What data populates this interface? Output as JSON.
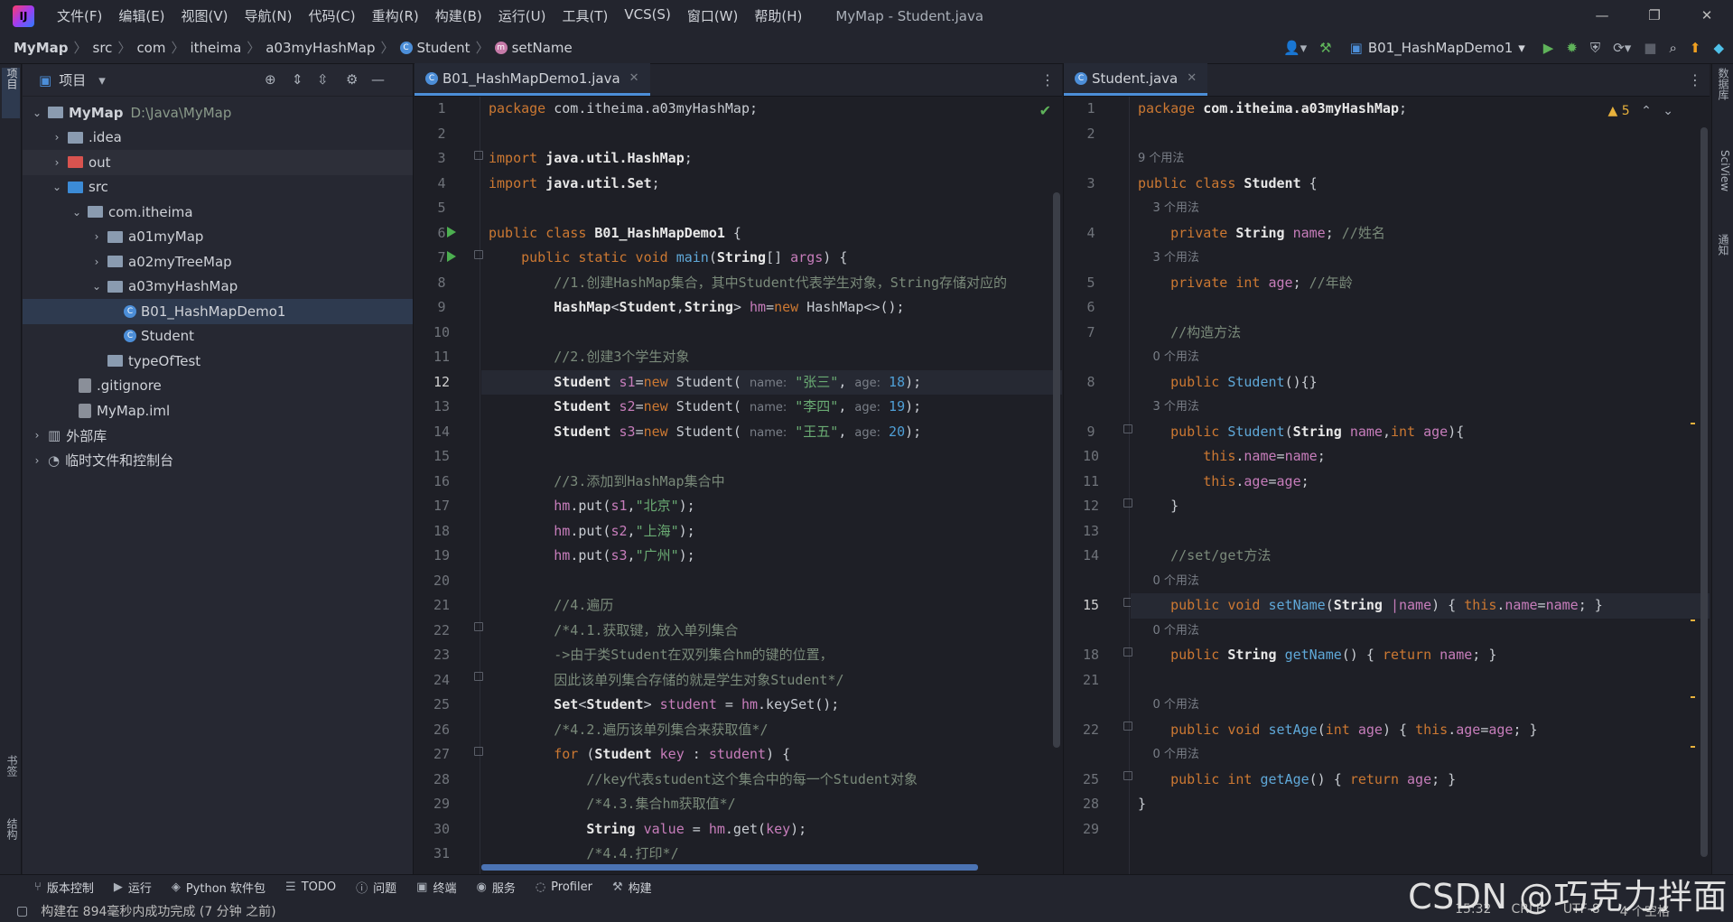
{
  "titlebar": {
    "logo": "IJ",
    "menu": [
      "文件(F)",
      "编辑(E)",
      "视图(V)",
      "导航(N)",
      "代码(C)",
      "重构(R)",
      "构建(B)",
      "运行(U)",
      "工具(T)",
      "VCS(S)",
      "窗口(W)",
      "帮助(H)"
    ],
    "title": "MyMap - Student.java"
  },
  "breadcrumb": [
    "MyMap",
    "src",
    "com",
    "itheima",
    "a03myHashMap",
    "Student",
    "setName"
  ],
  "run_config": "B01_HashMapDemo1",
  "project": {
    "header": "项目",
    "tree": [
      {
        "name": "MyMap",
        "path": "D:\\Java\\MyMap"
      },
      {
        "name": ".idea"
      },
      {
        "name": "out"
      },
      {
        "name": "src"
      },
      {
        "name": "com.itheima"
      },
      {
        "name": "a01myMap"
      },
      {
        "name": "a02myTreeMap"
      },
      {
        "name": "a03myHashMap"
      },
      {
        "name": "B01_HashMapDemo1"
      },
      {
        "name": "Student"
      },
      {
        "name": "typeOfTest"
      },
      {
        "name": ".gitignore"
      },
      {
        "name": "MyMap.iml"
      },
      {
        "name": "外部库"
      },
      {
        "name": "临时文件和控制台"
      }
    ]
  },
  "left_strip": {
    "project": "项目",
    "bookmarks": "书签",
    "structure": "结构"
  },
  "right_strip": {
    "database": "数据库",
    "sciview": "SciView",
    "notify": "通知"
  },
  "editor1": {
    "tab": "B01_HashMapDemo1.java",
    "lines": [
      "1",
      "2",
      "3",
      "4",
      "5",
      "6",
      "7",
      "8",
      "9",
      "10",
      "11",
      "12",
      "13",
      "14",
      "15",
      "16",
      "17",
      "18",
      "19",
      "20",
      "21",
      "22",
      "23",
      "24",
      "25",
      "26",
      "27",
      "28",
      "29",
      "30",
      "31"
    ]
  },
  "editor2": {
    "tab": "Student.java",
    "warnings": "5",
    "lines": [
      "1",
      "2",
      "3",
      "4",
      "5",
      "6",
      "7",
      "8",
      "9",
      "10",
      "11",
      "12",
      "13",
      "14",
      "15",
      "18",
      "21",
      "22",
      "25",
      "28",
      "29"
    ]
  },
  "bottom_tools": [
    "版本控制",
    "运行",
    "Python 软件包",
    "TODO",
    "问题",
    "终端",
    "服务",
    "Profiler",
    "构建"
  ],
  "status": {
    "message": "构建在 894毫秒内成功完成 (7 分钟 之前)",
    "position": "15:32",
    "line_sep": "CRLF",
    "encoding": "UTF-8",
    "indent": "4 个空格"
  },
  "watermark": "CSDN @巧克力拌面"
}
